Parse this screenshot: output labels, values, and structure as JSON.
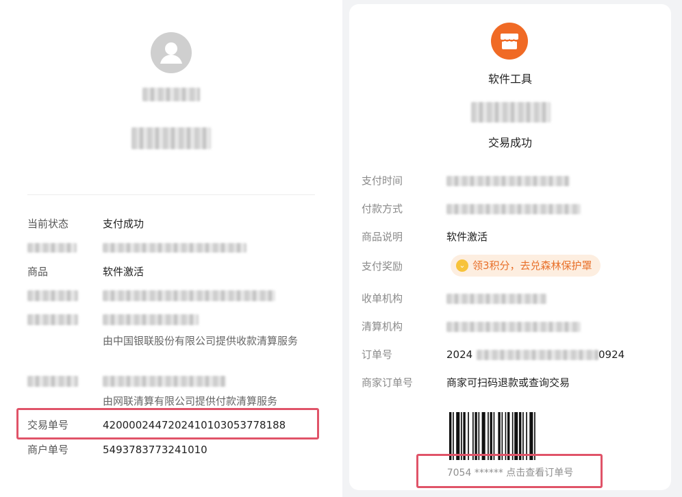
{
  "left_receipt": {
    "fields": {
      "status_label": "当前状态",
      "status_value": "支付成功",
      "product_label": "商品",
      "product_value": "软件激活",
      "clearing_note": "由中国银联股份有限公司提供收款清算服务",
      "payment_note": "由网联清算有限公司提供付款清算服务",
      "transaction_no_label": "交易单号",
      "transaction_no_value": "4200002447202410103053778188",
      "merchant_no_label": "商户单号",
      "merchant_no_value": "5493783773241010"
    }
  },
  "right_receipt": {
    "merchant_icon": "storefront-icon",
    "merchant_name": "软件工具",
    "status": "交易成功",
    "fields": {
      "pay_time_label": "支付时间",
      "pay_method_label": "付款方式",
      "product_desc_label": "商品说明",
      "product_desc_value": "软件激活",
      "reward_label": "支付奖励",
      "reward_value": "领3积分，去兑森林保护罩",
      "acquirer_label": "收单机构",
      "clearing_label": "清算机构",
      "order_no_label": "订单号",
      "order_no_prefix": "2024",
      "order_no_suffix": "0924",
      "merchant_order_label": "商家订单号",
      "merchant_order_value": "商家可扫码退款或查询交易"
    },
    "barcode_caption": "7054 ****** 点击查看订单号"
  },
  "colors": {
    "highlight": "#e05368",
    "merchant_orange": "#f06a25",
    "reward_bg": "#fdeee0",
    "reward_text": "#e8702a"
  }
}
